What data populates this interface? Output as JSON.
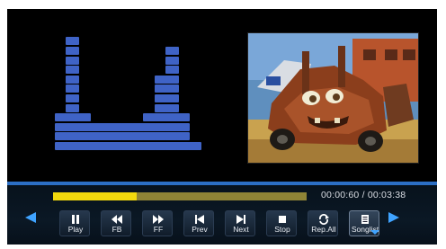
{
  "equalizer": {
    "bar_color": "#3f63c6",
    "levels": [
      4,
      12,
      4,
      3,
      3,
      3,
      3,
      3,
      4,
      8,
      11,
      4,
      1
    ]
  },
  "video": {
    "scene": "animated-car-frame"
  },
  "progress": {
    "fraction": 0.33,
    "fill_color": "#f2d90d",
    "track_color": "#8f8436"
  },
  "time": {
    "current": "00:00:60",
    "separator": "/",
    "total": "00:03:38"
  },
  "controls": [
    {
      "label": "Play",
      "icon": "pause-icon"
    },
    {
      "label": "FB",
      "icon": "fast-backward-icon"
    },
    {
      "label": "FF",
      "icon": "fast-forward-icon"
    },
    {
      "label": "Prev",
      "icon": "previous-icon"
    },
    {
      "label": "Next",
      "icon": "next-icon"
    },
    {
      "label": "Stop",
      "icon": "stop-icon"
    },
    {
      "label": "Rep.All",
      "icon": "repeat-icon"
    },
    {
      "label": "Songlist",
      "icon": "songlist-icon",
      "selected": true
    }
  ],
  "accent_color": "#3fa3ff"
}
